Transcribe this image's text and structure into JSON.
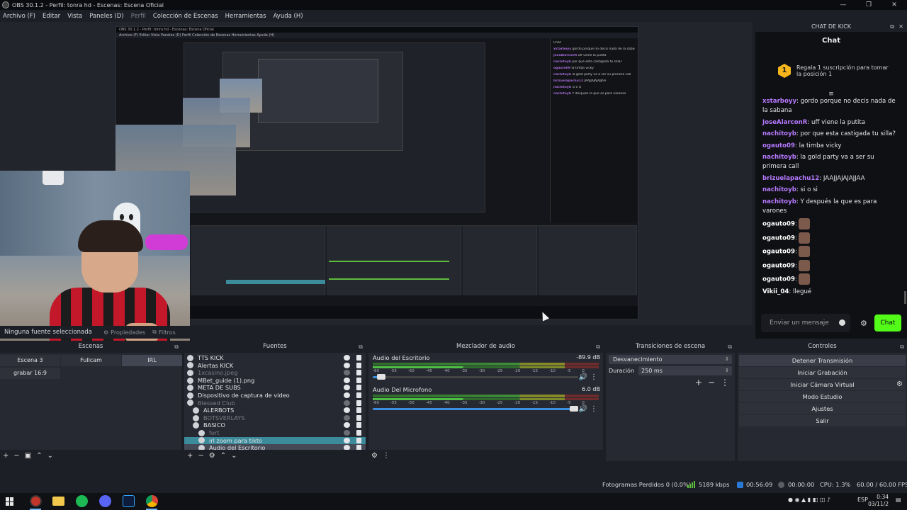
{
  "window": {
    "title": "OBS 30.1.2 - Perfil: tonra hd - Escenas: Escena Oficial"
  },
  "menu": [
    {
      "label": "Archivo (F)",
      "dim": false
    },
    {
      "label": "Editar",
      "dim": false
    },
    {
      "label": "Vista",
      "dim": false
    },
    {
      "label": "Paneles (D)",
      "dim": false
    },
    {
      "label": "Perfil",
      "dim": true
    },
    {
      "label": "Colección de Escenas",
      "dim": false
    },
    {
      "label": "Herramientas",
      "dim": false
    },
    {
      "label": "Ayuda (H)",
      "dim": false
    }
  ],
  "preview": {
    "nested_title": "OBS 30.1.2 - Perfil: tonra hd - Escenas: Escena Oficial",
    "nested_menu": "Archivo (F)   Editar   Vista   Paneles (D)   Perfil   Colección de Escenas   Herramientas   Ayuda (H)",
    "footer_none_selected": "Ninguna fuente seleccionada",
    "footer_properties": "Propiedades",
    "footer_filters": "Filtros"
  },
  "chat": {
    "dock_title": "CHAT DE KICK",
    "title": "Chat",
    "promo_badge": "1",
    "promo_text": "Regala 1 suscripción para tomar la posición 1",
    "messages": [
      {
        "user": "xstarboyy",
        "color": "#b679ff",
        "text": " gordo porque no decis nada de la sabana",
        "emote": false
      },
      {
        "user": "JoseAlarconR",
        "color": "#b679ff",
        "text": " uff viene la putita",
        "emote": false
      },
      {
        "user": "nachitoyb",
        "color": "#b679ff",
        "text": " por que esta castigada tu silla?",
        "emote": false
      },
      {
        "user": "ogauto09",
        "color": "#b679ff",
        "text": " la timba vicky",
        "emote": false
      },
      {
        "user": "nachitoyb",
        "color": "#b679ff",
        "text": " la gold party va a ser su primera call",
        "emote": false
      },
      {
        "user": "brizuelapachu12",
        "color": "#b679ff",
        "text": " JAAJJAJAJAJJAA",
        "emote": false
      },
      {
        "user": "nachitoyb",
        "color": "#b679ff",
        "text": " si o si",
        "emote": false
      },
      {
        "user": "nachitoyb",
        "color": "#b679ff",
        "text": " Y después la que es para varones",
        "emote": false
      },
      {
        "user": "ogauto09",
        "color": "#ffffff",
        "text": "",
        "emote": true
      },
      {
        "user": "ogauto09",
        "color": "#ffffff",
        "text": "",
        "emote": true
      },
      {
        "user": "ogauto09",
        "color": "#ffffff",
        "text": "",
        "emote": true
      },
      {
        "user": "ogauto09",
        "color": "#ffffff",
        "text": "",
        "emote": true
      },
      {
        "user": "ogauto09",
        "color": "#ffffff",
        "text": "",
        "emote": true
      },
      {
        "user": "Vikii_04",
        "color": "#ffffff",
        "text": " llegué",
        "emote": false
      }
    ],
    "input_placeholder": "Enviar un mensaje",
    "send_label": "Chat"
  },
  "docks": {
    "scenes": {
      "title": "Escenas",
      "items": [
        {
          "label": "Escena 3",
          "selected": false
        },
        {
          "label": "Fullcam",
          "selected": false
        },
        {
          "label": "IRL",
          "selected": true
        },
        {
          "label": "grabar 16:9",
          "selected": false
        }
      ]
    },
    "sources": {
      "title": "Fuentes",
      "items": [
        {
          "label": "TTS KICK",
          "state": "normal",
          "indent": 0
        },
        {
          "label": "Alertas KICK",
          "state": "normal",
          "indent": 0
        },
        {
          "label": "1xcasino.jpeg",
          "state": "dim",
          "indent": 0
        },
        {
          "label": "MBet_guide (1).png",
          "state": "normal",
          "indent": 0
        },
        {
          "label": "META DE SUBS",
          "state": "normal",
          "indent": 0
        },
        {
          "label": "Dispositivo de captura de video",
          "state": "normal",
          "indent": 0
        },
        {
          "label": "Blessed Club",
          "state": "dim",
          "indent": 0
        },
        {
          "label": "ALERBOTS",
          "state": "normal",
          "indent": 1
        },
        {
          "label": "BOTSVERLAYS",
          "state": "dim",
          "indent": 1
        },
        {
          "label": "BASICO",
          "state": "normal",
          "indent": 1
        },
        {
          "label": "fort",
          "state": "dim",
          "indent": 2
        },
        {
          "label": "irl zoom para tikto",
          "state": "selected",
          "indent": 2
        },
        {
          "label": "Audio del Escritorio",
          "state": "selected2",
          "indent": 2
        },
        {
          "label": "Audio Del Microfono",
          "state": "selected2",
          "indent": 2
        }
      ]
    },
    "mixer": {
      "title": "Mezclador de audio",
      "ticks": [
        "-60",
        "-55",
        "-50",
        "-45",
        "-40",
        "-35",
        "-30",
        "-25",
        "-20",
        "-15",
        "-10",
        "-5",
        "0"
      ],
      "channels": [
        {
          "name": "Audio del Escritorio",
          "db": "-89.9 dB",
          "volume": 0.04
        },
        {
          "name": "Audio Del Microfono",
          "db": "6.0 dB",
          "volume": 0.98
        }
      ]
    },
    "transitions": {
      "title": "Transiciones de escena",
      "selected": "Desvanecimiento",
      "duration_label": "Duración",
      "duration_value": "250 ms"
    },
    "controls": {
      "title": "Controles",
      "buttons": [
        {
          "label": "Detener Transmisión",
          "active": true
        },
        {
          "label": "Iniciar Grabación",
          "active": false
        },
        {
          "label": "Iniciar Cámara Virtual",
          "active": false
        },
        {
          "label": "Modo Estudio",
          "active": false
        },
        {
          "label": "Ajustes",
          "active": false
        },
        {
          "label": "Salir",
          "active": false
        }
      ]
    }
  },
  "status": {
    "dropped": "Fotogramas Perdidos 0 (0.0%)",
    "bitrate": "5189 kbps",
    "live_time": "00:56:09",
    "rec_time": "00:00:00",
    "cpu": "CPU: 1.3%",
    "fps": "60.00 / 60.00 FPS"
  },
  "taskbar": {
    "lang": "ESP",
    "time": "0:34",
    "date": "03/11/2"
  },
  "colors": {
    "accent_teal": "#3c8b9b",
    "kick_green": "#53fc18",
    "badge_gold": "#f4b61b"
  }
}
